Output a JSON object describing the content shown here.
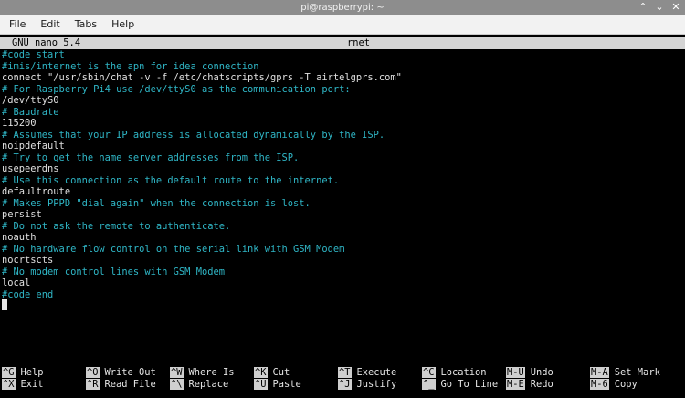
{
  "window": {
    "title": "pi@raspberrypi: ~",
    "controls": {
      "minimize": "⌃",
      "maximize": "⌄",
      "close": "✕"
    }
  },
  "menubar": {
    "items": [
      "File",
      "Edit",
      "Tabs",
      "Help"
    ]
  },
  "nano": {
    "version": "GNU nano 5.4",
    "filename": "rnet",
    "lines": [
      {
        "text": "#code start",
        "type": "comment"
      },
      {
        "text": "#imis/internet is the apn for idea connection",
        "type": "comment"
      },
      {
        "text": "connect \"/usr/sbin/chat -v -f /etc/chatscripts/gprs -T airtelgprs.com\"",
        "type": "code"
      },
      {
        "text": "# For Raspberry Pi4 use /dev/ttyS0 as the communication port:",
        "type": "comment"
      },
      {
        "text": "/dev/ttyS0",
        "type": "code"
      },
      {
        "text": "# Baudrate",
        "type": "comment"
      },
      {
        "text": "115200",
        "type": "code"
      },
      {
        "text": "# Assumes that your IP address is allocated dynamically by the ISP.",
        "type": "comment"
      },
      {
        "text": "noipdefault",
        "type": "code"
      },
      {
        "text": "# Try to get the name server addresses from the ISP.",
        "type": "comment"
      },
      {
        "text": "usepeerdns",
        "type": "code"
      },
      {
        "text": "# Use this connection as the default route to the internet.",
        "type": "comment"
      },
      {
        "text": "defaultroute",
        "type": "code"
      },
      {
        "text": "# Makes PPPD \"dial again\" when the connection is lost.",
        "type": "comment"
      },
      {
        "text": "persist",
        "type": "code"
      },
      {
        "text": "# Do not ask the remote to authenticate.",
        "type": "comment"
      },
      {
        "text": "noauth",
        "type": "code"
      },
      {
        "text": "# No hardware flow control on the serial link with GSM Modem",
        "type": "comment"
      },
      {
        "text": "nocrtscts",
        "type": "code"
      },
      {
        "text": "# No modem control lines with GSM Modem",
        "type": "comment"
      },
      {
        "text": "local",
        "type": "code"
      },
      {
        "text": "#code end",
        "type": "comment"
      }
    ],
    "shortcuts": [
      {
        "key": "^G",
        "label": "Help"
      },
      {
        "key": "^X",
        "label": "Exit"
      },
      {
        "key": "^O",
        "label": "Write Out"
      },
      {
        "key": "^R",
        "label": "Read File"
      },
      {
        "key": "^W",
        "label": "Where Is"
      },
      {
        "key": "^\\",
        "label": "Replace"
      },
      {
        "key": "^K",
        "label": "Cut"
      },
      {
        "key": "^U",
        "label": "Paste"
      },
      {
        "key": "^T",
        "label": "Execute"
      },
      {
        "key": "^J",
        "label": "Justify"
      },
      {
        "key": "^C",
        "label": "Location"
      },
      {
        "key": "^_",
        "label": "Go To Line"
      },
      {
        "key": "M-U",
        "label": "Undo"
      },
      {
        "key": "M-E",
        "label": "Redo"
      },
      {
        "key": "M-A",
        "label": "Set Mark"
      },
      {
        "key": "M-6",
        "label": "Copy"
      }
    ]
  },
  "colors": {
    "comment": "#2fb6c6",
    "code": "#e0e0e0",
    "header_bg": "#d4d4d4",
    "titlebar_bg": "#8d8d8d",
    "menubar_bg": "#f2f2f2"
  }
}
